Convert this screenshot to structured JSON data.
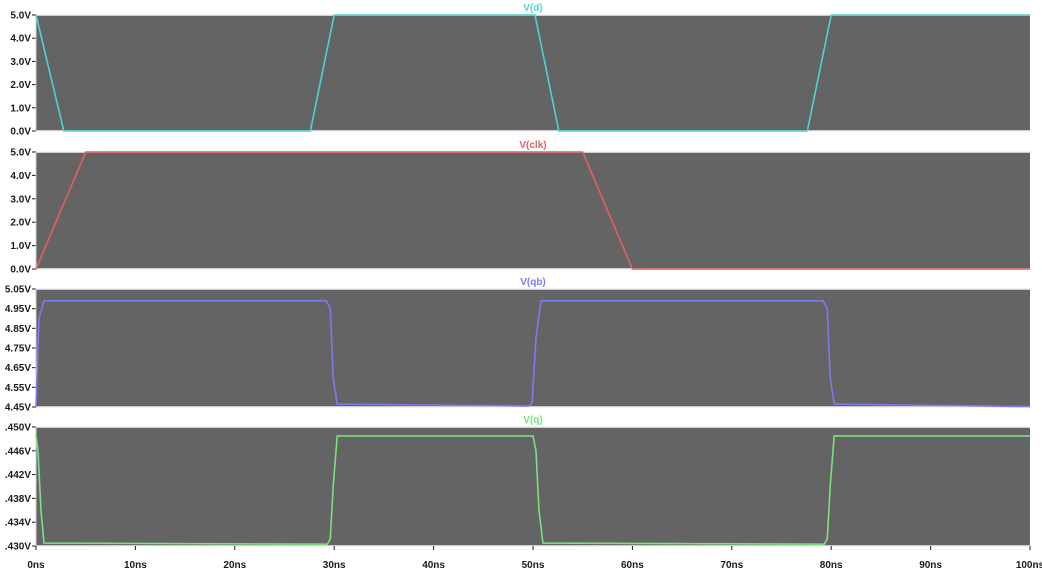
{
  "chart_data": [
    {
      "type": "line",
      "title": "V(d)",
      "color": "#4fd3d3",
      "y_ticks": [
        "5.0V",
        "4.0V",
        "3.0V",
        "2.0V",
        "1.0V",
        "0.0V"
      ],
      "ylim": [
        0,
        5
      ],
      "x_unit": "ns",
      "y_unit": "V",
      "points": [
        [
          0,
          5.0
        ],
        [
          2.8,
          0.0
        ],
        [
          27.6,
          0.0
        ],
        [
          30.0,
          5.0
        ],
        [
          50.2,
          5.0
        ],
        [
          52.6,
          0.0
        ],
        [
          77.6,
          0.0
        ],
        [
          80.0,
          5.0
        ],
        [
          100,
          5.0
        ]
      ]
    },
    {
      "type": "line",
      "title": "V(clk)",
      "color": "#e06060",
      "y_ticks": [
        "5.0V",
        "4.0V",
        "3.0V",
        "2.0V",
        "1.0V",
        "0.0V"
      ],
      "ylim": [
        0,
        5
      ],
      "x_unit": "ns",
      "y_unit": "V",
      "points": [
        [
          0,
          0.0
        ],
        [
          5.0,
          5.0
        ],
        [
          55.0,
          5.0
        ],
        [
          60.0,
          0.0
        ],
        [
          100,
          0.0
        ]
      ]
    },
    {
      "type": "line",
      "title": "V(qb)",
      "color": "#7b7bf0",
      "y_ticks": [
        "5.05V",
        "4.95V",
        "4.85V",
        "4.75V",
        "4.65V",
        "4.55V",
        "4.45V"
      ],
      "ylim": [
        4.45,
        5.05
      ],
      "x_unit": "ns",
      "y_unit": "V",
      "points": [
        [
          0,
          4.45
        ],
        [
          0.3,
          4.9
        ],
        [
          0.8,
          4.99
        ],
        [
          29.2,
          4.99
        ],
        [
          29.6,
          4.95
        ],
        [
          29.9,
          4.6
        ],
        [
          30.3,
          4.465
        ],
        [
          49.6,
          4.455
        ],
        [
          49.9,
          4.47
        ],
        [
          50.3,
          4.8
        ],
        [
          50.8,
          4.99
        ],
        [
          79.2,
          4.99
        ],
        [
          79.6,
          4.95
        ],
        [
          79.9,
          4.6
        ],
        [
          80.3,
          4.465
        ],
        [
          100,
          4.452
        ]
      ]
    },
    {
      "type": "line",
      "title": "V(q)",
      "color": "#7ee07e",
      "y_ticks": [
        ".450V",
        ".446V",
        ".442V",
        ".438V",
        ".434V",
        ".430V"
      ],
      "ylim": [
        0.43,
        0.45
      ],
      "x_unit": "ns",
      "y_unit": "V",
      "points": [
        [
          0,
          0.4485
        ],
        [
          0.2,
          0.446
        ],
        [
          0.5,
          0.436
        ],
        [
          0.8,
          0.4305
        ],
        [
          29.3,
          0.4303
        ],
        [
          29.6,
          0.4312
        ],
        [
          29.9,
          0.44
        ],
        [
          30.3,
          0.4485
        ],
        [
          50.0,
          0.4485
        ],
        [
          50.3,
          0.446
        ],
        [
          50.6,
          0.436
        ],
        [
          51.0,
          0.4305
        ],
        [
          79.3,
          0.4303
        ],
        [
          79.6,
          0.4312
        ],
        [
          79.9,
          0.44
        ],
        [
          80.3,
          0.4485
        ],
        [
          100,
          0.4485
        ]
      ]
    }
  ],
  "x_axis": {
    "xlim": [
      0,
      100
    ],
    "tick_labels": [
      "0ns",
      "10ns",
      "20ns",
      "30ns",
      "40ns",
      "50ns",
      "60ns",
      "70ns",
      "80ns",
      "90ns",
      "100ns"
    ]
  },
  "colors": {
    "panel_background": "#646464",
    "grid": "#505050",
    "axis_line": "#f0f0f0"
  }
}
